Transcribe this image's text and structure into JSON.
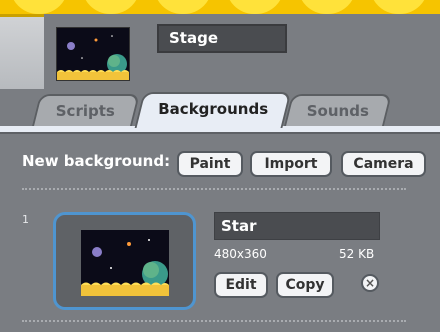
{
  "stage": {
    "name": "Stage"
  },
  "tabs": [
    {
      "label": "Scripts"
    },
    {
      "label": "Backgrounds"
    },
    {
      "label": "Sounds"
    }
  ],
  "new_background": {
    "label": "New background:",
    "buttons": [
      "Paint",
      "Import",
      "Camera"
    ]
  },
  "costumes": [
    {
      "index": "1",
      "name": "Star",
      "dimensions": "480x360",
      "size": "52 KB",
      "edit_label": "Edit",
      "copy_label": "Copy",
      "delete_icon": "close-icon"
    }
  ],
  "colors": {
    "panel": "#7a7d82",
    "active_tab": "#e8edf5",
    "selection_border": "#4f95d0",
    "stage_yellow": "#f6c400"
  }
}
